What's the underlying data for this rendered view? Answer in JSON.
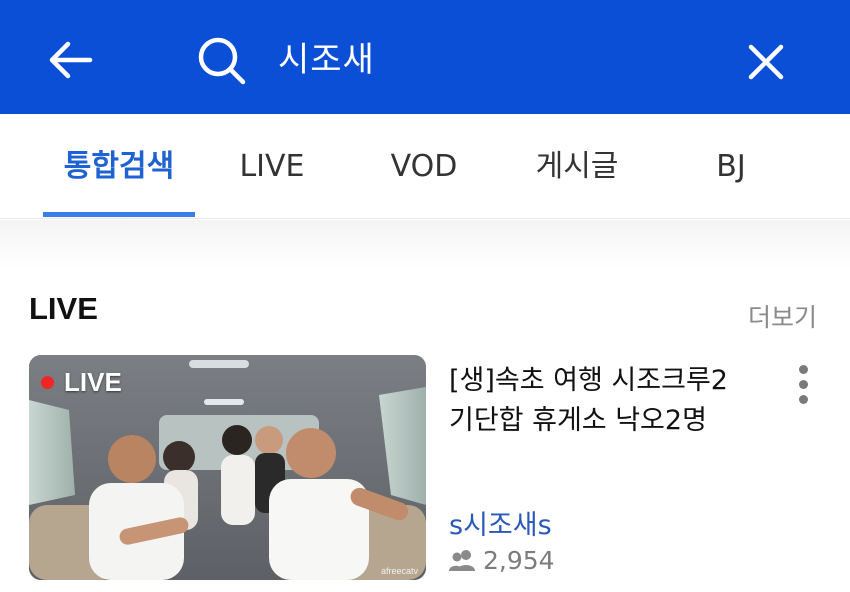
{
  "header": {
    "query": "시조새",
    "back_icon": "back-arrow-icon",
    "search_icon": "search-icon",
    "close_icon": "close-icon",
    "background_color": "#0a4fd6"
  },
  "tabs": [
    {
      "label": "통합검색",
      "active": true
    },
    {
      "label": "LIVE",
      "active": false
    },
    {
      "label": "VOD",
      "active": false
    },
    {
      "label": "게시글",
      "active": false
    },
    {
      "label": "BJ",
      "active": false
    }
  ],
  "section": {
    "title": "LIVE",
    "more_label": "더보기"
  },
  "card": {
    "badge": "LIVE",
    "title_line1": "[생]속초 여행 시조크루2",
    "title_line2": "기단합 휴게소 낙오2명",
    "channel": "s시조새s",
    "viewer_count": "2,954",
    "viewer_icon": "viewers-icon",
    "watermark": "afreecatv"
  },
  "colors": {
    "accent": "#1f63d2",
    "live_dot": "#f02626",
    "channel": "#2a59b7"
  }
}
